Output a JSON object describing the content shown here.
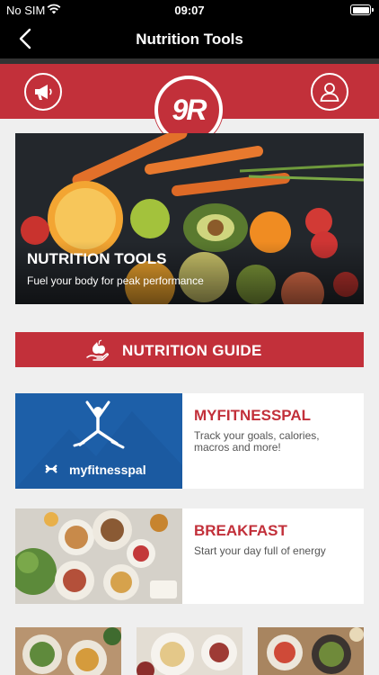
{
  "status_bar": {
    "carrier": "No SIM",
    "time": "09:07",
    "wifi_icon": "wifi-icon",
    "battery_icon": "battery-icon"
  },
  "nav": {
    "title": "Nutrition Tools",
    "back_icon": "chevron-left-icon"
  },
  "brand": {
    "logo_text": "9R",
    "announce_icon": "megaphone-icon",
    "profile_icon": "user-icon",
    "accent": "#c2303a"
  },
  "hero": {
    "title": "NUTRITION TOOLS",
    "subtitle": "Fuel your body for peak performance"
  },
  "guide": {
    "label": "NUTRITION GUIDE",
    "icon": "apple-hand-icon"
  },
  "cards": [
    {
      "title": "MYFITNESSPAL",
      "description": "Track your goals, calories, macros and more!",
      "thumb_label": "myfitnesspal"
    },
    {
      "title": "BREAKFAST",
      "description": "Start your day full of energy"
    }
  ]
}
